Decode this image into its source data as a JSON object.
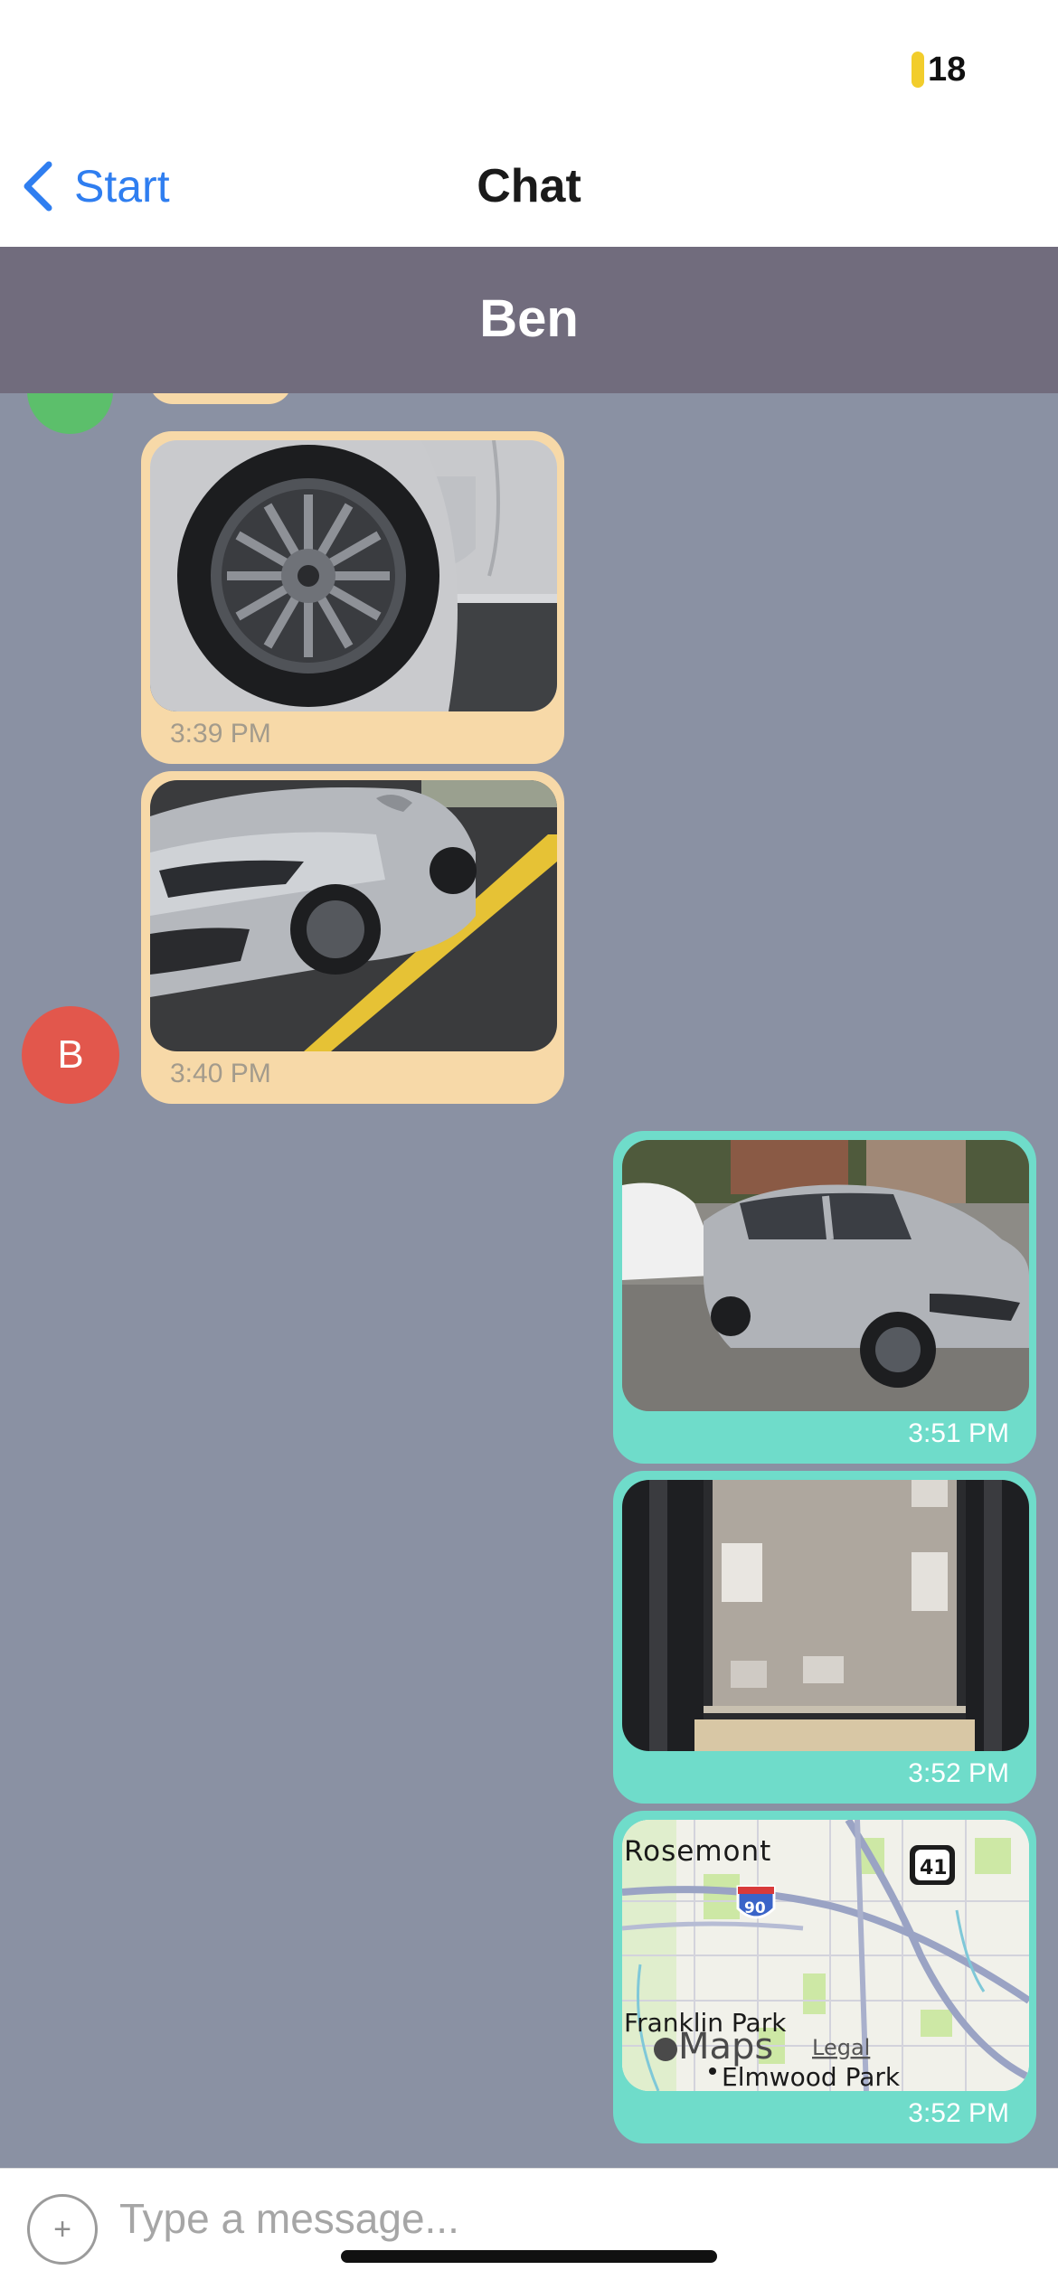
{
  "status_bar": {
    "battery": "18",
    "battery_color": "#f2cd2c"
  },
  "nav": {
    "back_label": "Start",
    "title": "Chat",
    "accent": "#2f7ef0"
  },
  "chat_header": {
    "title": "Ben",
    "background": "#716c7d"
  },
  "contact": {
    "avatar_letter": "B",
    "avatar_color": "#e2574c"
  },
  "colors": {
    "incoming_bubble": "#f7d9a8",
    "outgoing_bubble": "#6fdcca",
    "chat_background": "#8a91a3"
  },
  "messages": [
    {
      "direction": "incoming",
      "content": "photo: car wheel close-up",
      "time": "3:39 PM"
    },
    {
      "direction": "incoming",
      "content": "photo: silver hatchback front in parking lot",
      "time": "3:40 PM"
    },
    {
      "direction": "outgoing",
      "content": "photo: silver hatchback parked on street",
      "time": "3:51 PM"
    },
    {
      "direction": "outgoing",
      "content": "photo: window view",
      "time": "3:52 PM"
    },
    {
      "direction": "outgoing",
      "content": "map location",
      "time": "3:52 PM",
      "map": {
        "labels": [
          "Rosemont",
          "Franklin Park",
          "Elmwood Park"
        ],
        "route_shields": [
          "90",
          "41"
        ],
        "brand": "Maps",
        "legal": "Legal"
      }
    }
  ],
  "composer": {
    "placeholder": "Type a message...",
    "add_icon": "plus-icon"
  }
}
